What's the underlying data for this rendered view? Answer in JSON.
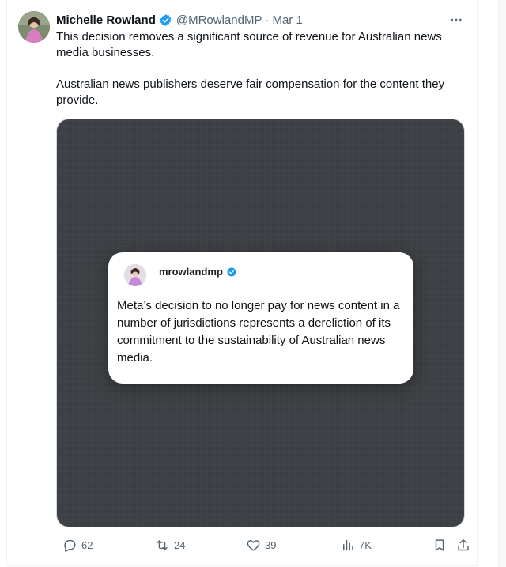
{
  "tweet": {
    "author_name": "Michelle Rowland",
    "handle": "@MRowlandMP",
    "separator": "·",
    "date": "Mar 1",
    "paragraphs": [
      "This decision removes a significant source of revenue for Australian news media businesses.",
      "Australian news publishers deserve fair compensation for the content they provide."
    ],
    "more_icon": "more-horizontal-icon"
  },
  "embedded_post": {
    "handle": "mrowlandmp",
    "text": "Meta’s decision to no longer pay for news content in a number of jurisdictions represents a dereliction of its commitment to the sustainability of Australian news media."
  },
  "actions": {
    "replies": "62",
    "reposts": "24",
    "likes": "39",
    "views": "7K"
  },
  "colors": {
    "verified": "#1d9bf0",
    "muted_text": "#536471",
    "media_bg": "#3b3e42"
  }
}
